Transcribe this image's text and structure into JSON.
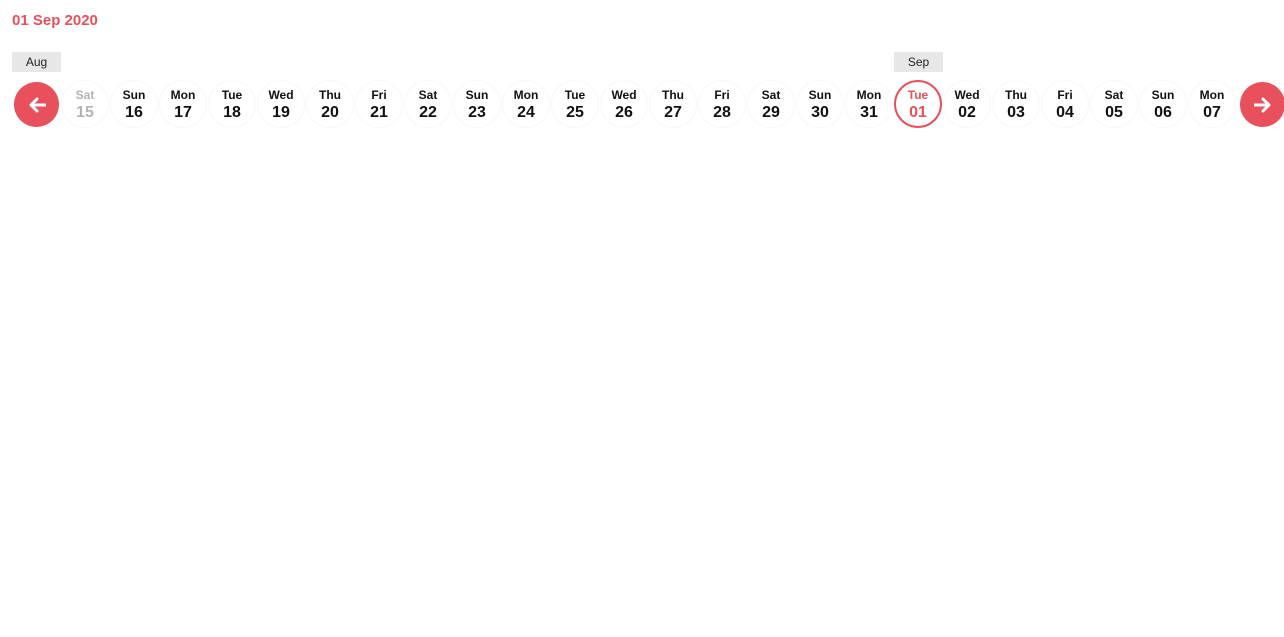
{
  "selected_date": "01 Sep 2020",
  "months": [
    {
      "label": "Aug",
      "start_day_index": 0
    },
    {
      "label": "Sep",
      "start_day_index": 17
    }
  ],
  "nav": {
    "prev_icon": "arrow-left-icon",
    "next_icon": "arrow-right-icon"
  },
  "colors": {
    "accent": "#e8505b",
    "month_bg": "#e7e7e7",
    "disabled_text": "#b3b3b3"
  },
  "days": [
    {
      "day": "Sat",
      "date": "15",
      "disabled": true
    },
    {
      "day": "Sun",
      "date": "16"
    },
    {
      "day": "Mon",
      "date": "17"
    },
    {
      "day": "Tue",
      "date": "18"
    },
    {
      "day": "Wed",
      "date": "19"
    },
    {
      "day": "Thu",
      "date": "20"
    },
    {
      "day": "Fri",
      "date": "21"
    },
    {
      "day": "Sat",
      "date": "22"
    },
    {
      "day": "Sun",
      "date": "23"
    },
    {
      "day": "Mon",
      "date": "24"
    },
    {
      "day": "Tue",
      "date": "25"
    },
    {
      "day": "Wed",
      "date": "26"
    },
    {
      "day": "Thu",
      "date": "27"
    },
    {
      "day": "Fri",
      "date": "28"
    },
    {
      "day": "Sat",
      "date": "29"
    },
    {
      "day": "Sun",
      "date": "30"
    },
    {
      "day": "Mon",
      "date": "31"
    },
    {
      "day": "Tue",
      "date": "01",
      "selected": true
    },
    {
      "day": "Wed",
      "date": "02"
    },
    {
      "day": "Thu",
      "date": "03"
    },
    {
      "day": "Fri",
      "date": "04"
    },
    {
      "day": "Sat",
      "date": "05"
    },
    {
      "day": "Sun",
      "date": "06"
    },
    {
      "day": "Mon",
      "date": "07"
    }
  ]
}
